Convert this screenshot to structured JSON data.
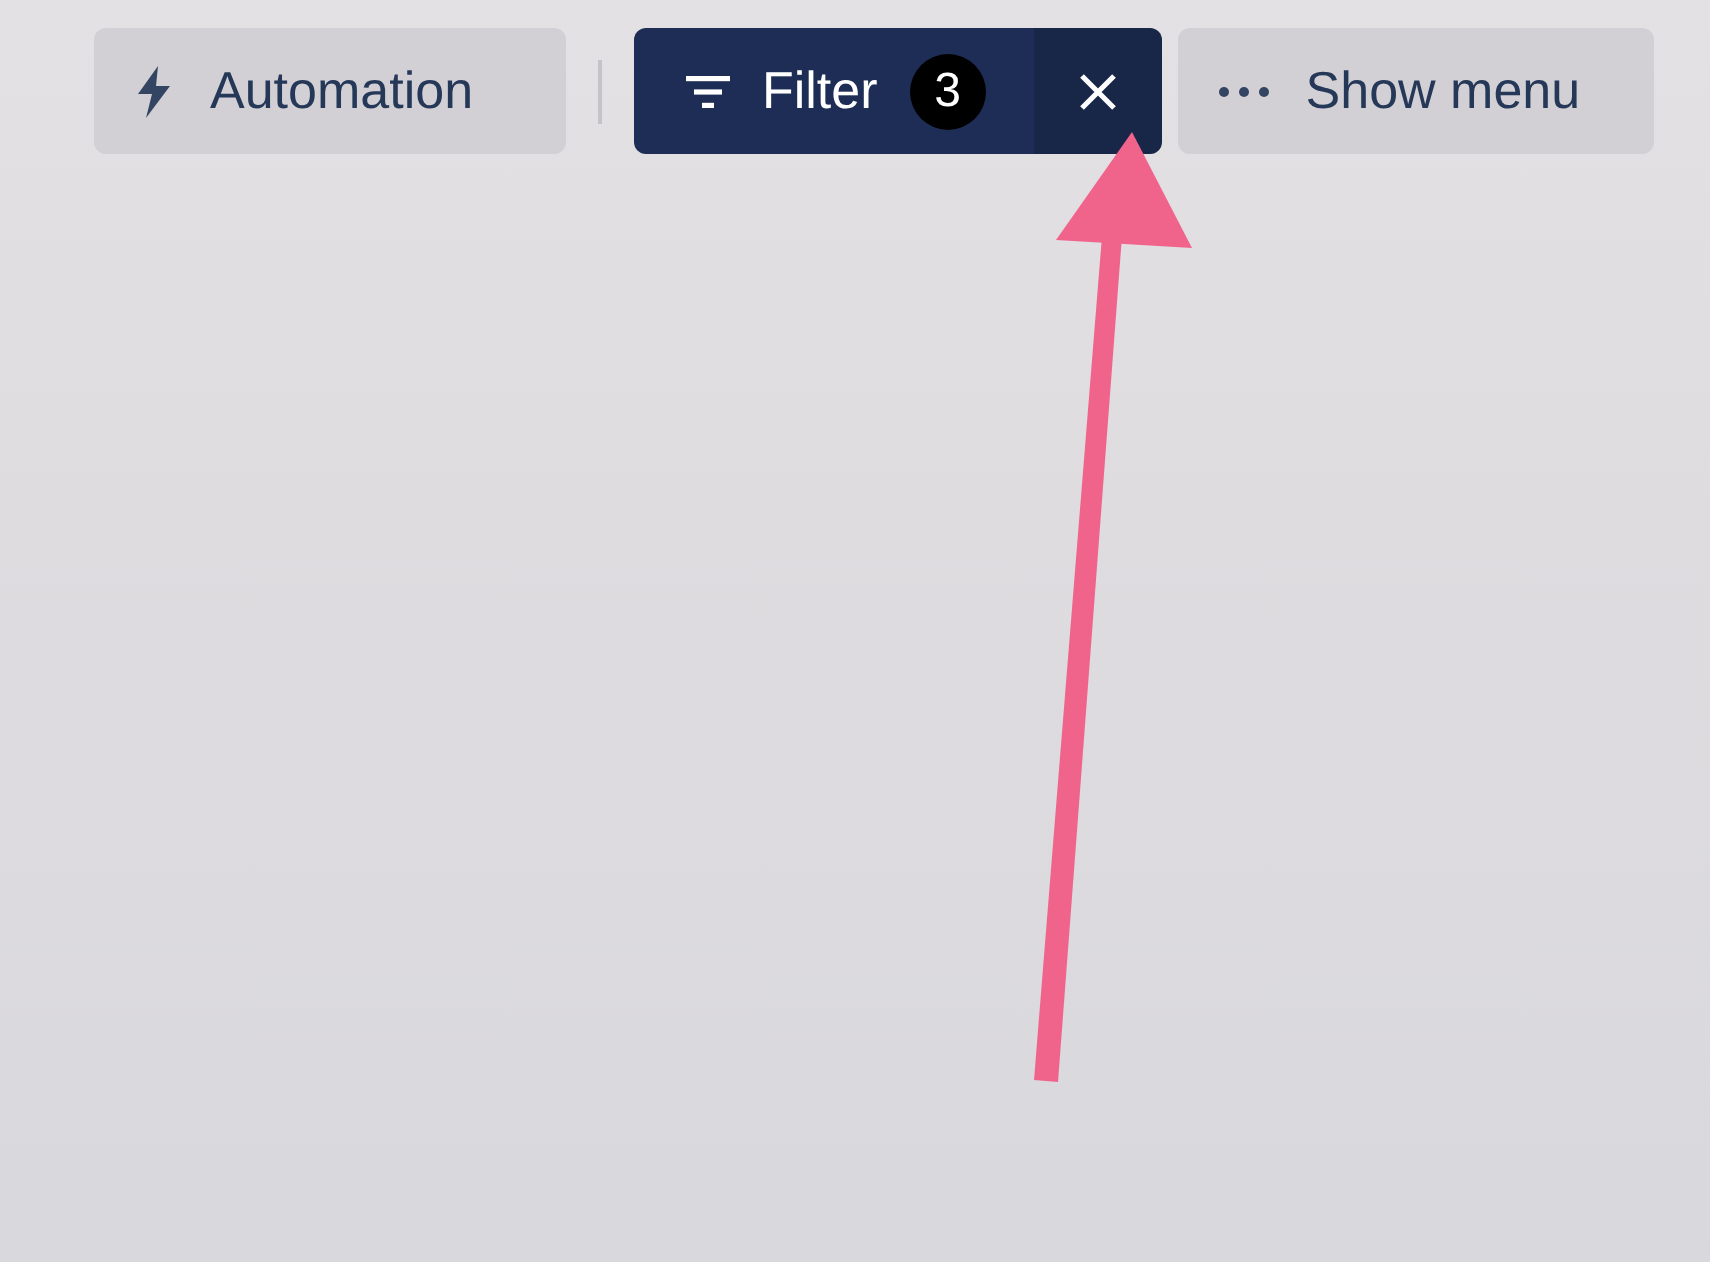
{
  "toolbar": [
    {
      "kind": "automation",
      "label": "Automation"
    },
    {
      "kind": "filter",
      "label": "Filter",
      "count": "3",
      "active": true
    },
    {
      "kind": "menu",
      "label": "Show menu"
    }
  ]
}
